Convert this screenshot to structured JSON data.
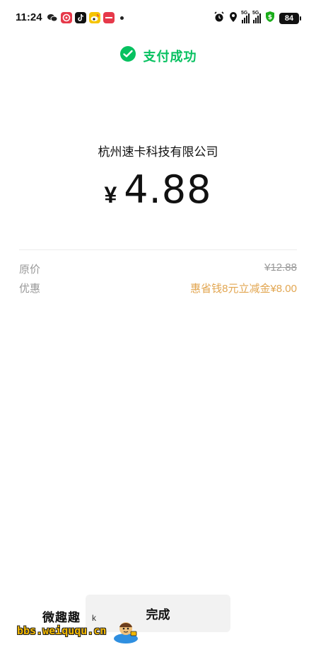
{
  "status_bar": {
    "time": "11:24",
    "battery": "84",
    "notification_icons": [
      "wechat-icon",
      "netease-music-icon",
      "tiktok-icon",
      "weibo-icon",
      "app-red-icon"
    ],
    "system_icons": [
      "alarm-icon",
      "location-icon",
      "signal-5g-icon",
      "signal-5g-icon",
      "vpn-shield-icon"
    ],
    "network": "5G"
  },
  "header": {
    "status_text": "支付成功",
    "accent_color": "#07c160"
  },
  "payment": {
    "merchant": "杭州速卡科技有限公司",
    "currency_symbol": "¥",
    "amount": "4.88"
  },
  "details": [
    {
      "label": "原价",
      "value": "¥12.88"
    },
    {
      "label": "优惠",
      "value": "惠省钱8元立减金¥8.00"
    }
  ],
  "discount_color": "#e2a651",
  "actions": {
    "done_label": "完成"
  },
  "watermark": {
    "title": "微趣趣",
    "url": "bbs.weiququ.cn",
    "glyph": "k"
  }
}
